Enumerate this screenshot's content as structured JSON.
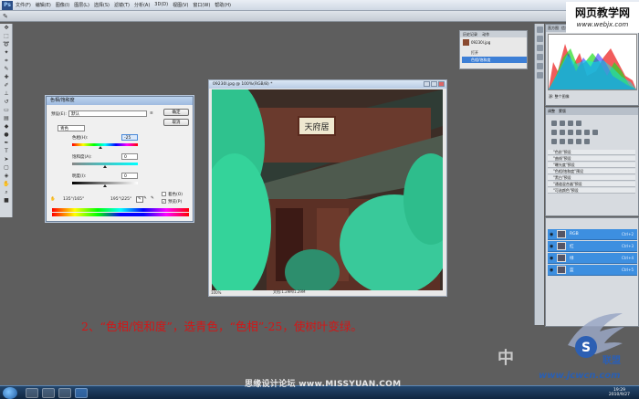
{
  "menubar": {
    "logo": "Ps",
    "items": [
      "文件(F)",
      "编辑(E)",
      "图像(I)",
      "图层(L)",
      "选择(S)",
      "滤镜(T)",
      "分析(A)",
      "3D(D)",
      "视图(V)",
      "窗口(W)",
      "帮助(H)"
    ]
  },
  "watermark_top": {
    "line1": "网页教学网",
    "line2": "www.webjx.com"
  },
  "hue_dialog": {
    "title": "色相/饱和度",
    "preset_label": "预设(E):",
    "preset_value": "默认",
    "channel": "青色",
    "hue_label": "色相(H):",
    "hue_value": "-25",
    "saturation_label": "饱和度(A):",
    "saturation_value": "0",
    "lightness_label": "明度(I):",
    "lightness_value": "0",
    "ok": "确定",
    "cancel": "取消",
    "colorize": "着色(O)",
    "preview": "预览(P)",
    "range_left": "135°/165°",
    "range_right": "195°\\225°",
    "hue_position": 0.43
  },
  "image_window": {
    "title": "09230l.jpg @ 100%(RGB/8) *",
    "zoom": "100%",
    "doc_info": "文档:1.29M/1.29M",
    "sign_text": "天府居"
  },
  "history": {
    "tabs": [
      "历史记录",
      "动作"
    ],
    "snapshot": "09230l.jpg",
    "items": [
      "打开",
      "色相/饱和度"
    ]
  },
  "histogram": {
    "tabs": [
      "直方图",
      "信息"
    ],
    "source": "源: 整个图像"
  },
  "adjustments": {
    "tabs": [
      "调整",
      "蒙版"
    ],
    "presets": [
      "\"色阶\"预设",
      "\"曲线\"预设",
      "\"曝光度\"预设",
      "\"色相/饱和度\"预设",
      "\"黑白\"预设",
      "\"通道混合器\"预设",
      "\"可选颜色\"预设"
    ]
  },
  "layers": {
    "rows": [
      {
        "name": "RGB",
        "key": "Ctrl+2"
      },
      {
        "name": "红",
        "key": "Ctrl+3"
      },
      {
        "name": "绿",
        "key": "Ctrl+4"
      },
      {
        "name": "蓝",
        "key": "Ctrl+5"
      }
    ]
  },
  "caption": "2、“色相/饱和度”，选青色，“色相”-25，使树叶变绿。",
  "watermarks": {
    "zh": "中",
    "bottom": "思缘设计论坛 www.MISSYUAN.COM",
    "site": "www.jcwcn.com",
    "logo_letter": "S",
    "logo_text": "联盟"
  },
  "taskbar": {
    "time": "19:29",
    "date": "2010/9/27"
  }
}
